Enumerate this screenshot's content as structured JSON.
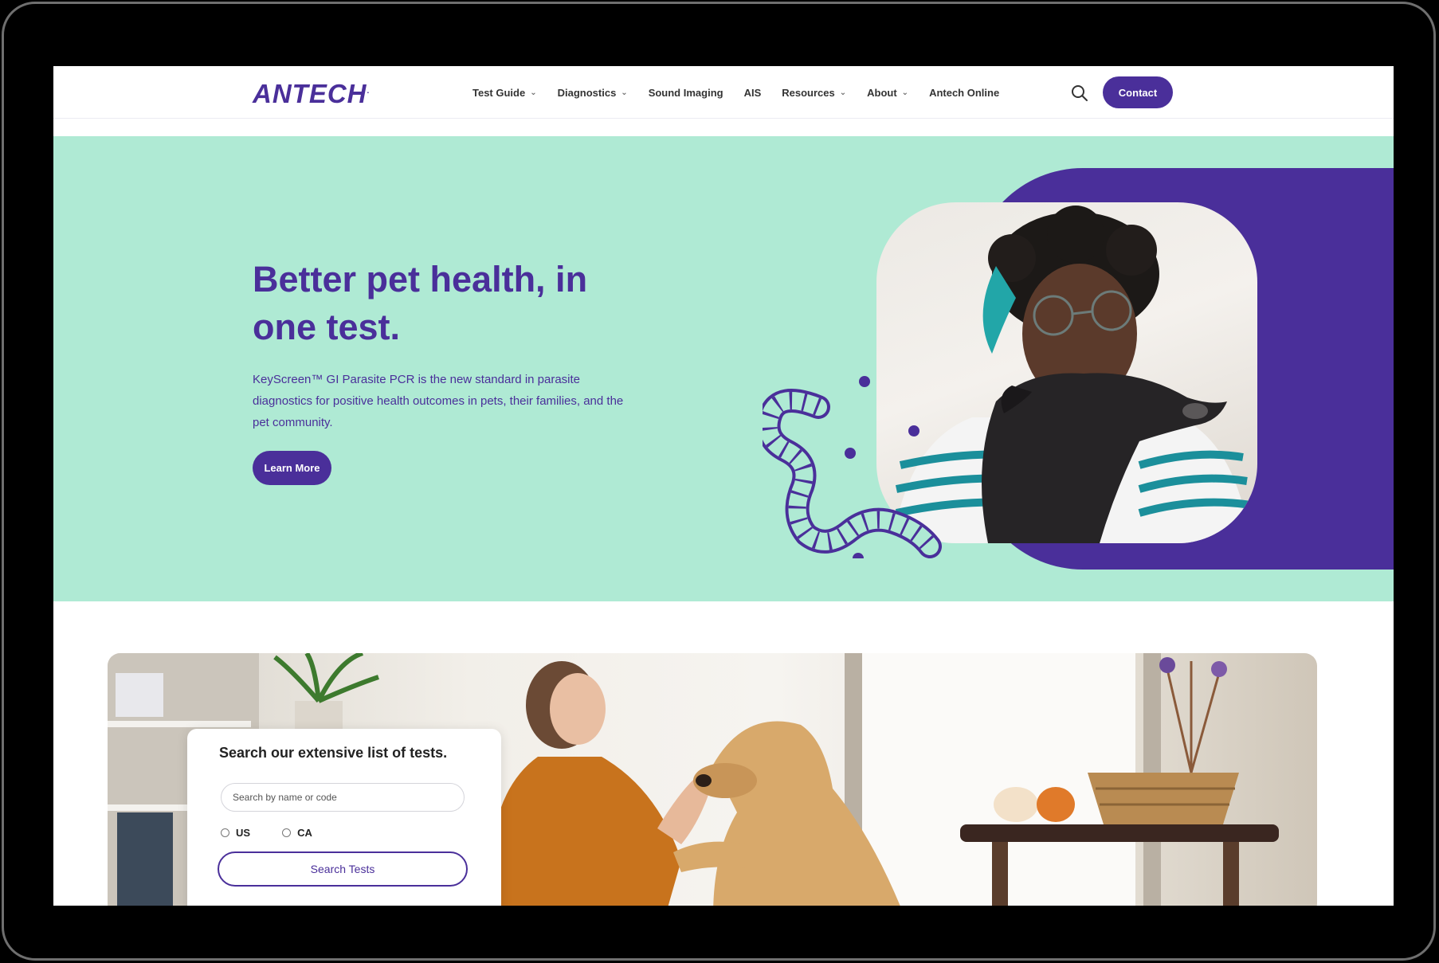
{
  "nav": {
    "logo": "ANTECH",
    "items": [
      {
        "label": "Test Guide",
        "dropdown": true
      },
      {
        "label": "Diagnostics",
        "dropdown": true
      },
      {
        "label": "Sound Imaging",
        "dropdown": false
      },
      {
        "label": "AIS",
        "dropdown": false
      },
      {
        "label": "Resources",
        "dropdown": true
      },
      {
        "label": "About",
        "dropdown": true
      },
      {
        "label": "Antech Online",
        "dropdown": false
      }
    ],
    "search_icon": "search-icon",
    "contact_label": "Contact"
  },
  "hero": {
    "title": "Better pet health, in one test.",
    "text": "KeyScreen™ GI Parasite PCR is the new standard in parasite diagnostics for positive health outcomes in pets, their families, and the pet community.",
    "button_label": "Learn More"
  },
  "test_search": {
    "title": "Search our extensive list of tests.",
    "placeholder": "Search by name or code",
    "value": "",
    "regions": [
      "US",
      "CA"
    ],
    "button_label": "Search Tests"
  },
  "colors": {
    "brand_purple": "#4a2f9a",
    "hero_mint": "#afead4"
  }
}
